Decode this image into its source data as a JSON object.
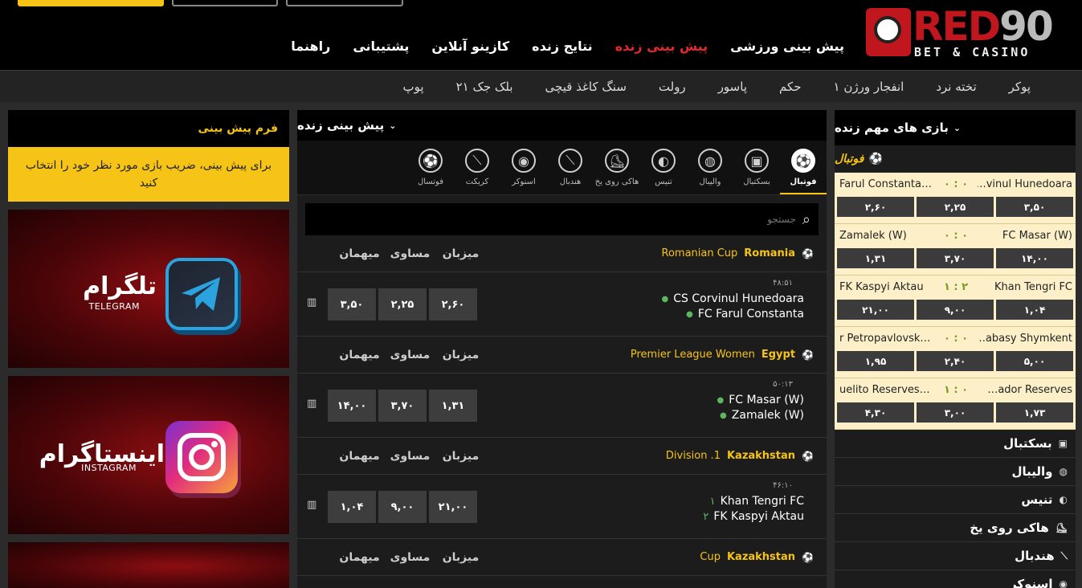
{
  "brand": {
    "logo_main": "RED90",
    "logo_r": "RED",
    "logo_n": "90",
    "logo_sub": "BET & CASINO"
  },
  "main_nav": [
    {
      "label": "پیش بینی ورزشی",
      "active": false
    },
    {
      "label": "پیش بینی زنده",
      "active": true
    },
    {
      "label": "نتایج زنده",
      "active": false
    },
    {
      "label": "کازینو آنلاین",
      "active": false
    },
    {
      "label": "پشتیبانی",
      "active": false
    },
    {
      "label": "راهنما",
      "active": false
    }
  ],
  "sub_nav": [
    "پوکر",
    "تخته نرد",
    "انفجار ورژن ۱",
    "حکم",
    "پاسور",
    "رولت",
    "سنگ کاغذ قیچی",
    "بلک جک ۲۱",
    "پوپ"
  ],
  "left": {
    "form_title": "فرم پیش بینی",
    "form_note": "برای پیش بینی، ضریب بازی مورد نظر خود را انتخاب کنید",
    "telegram": {
      "fa": "تلگرام",
      "en": "TELEGRAM"
    },
    "instagram": {
      "fa": "اینستاگرام",
      "en": "INSTAGRAM"
    }
  },
  "center": {
    "title": "پیش بینی زنده",
    "tabs": [
      {
        "label": "فوتبال",
        "icon": "football-icon",
        "glyph": "⚽",
        "active": true
      },
      {
        "label": "بسکتبال",
        "icon": "basketball-icon",
        "glyph": "▣",
        "active": false
      },
      {
        "label": "والیبال",
        "icon": "volleyball-icon",
        "glyph": "◍",
        "active": false
      },
      {
        "label": "تنیس",
        "icon": "tennis-icon",
        "glyph": "◐",
        "active": false
      },
      {
        "label": "هاکی روی یخ",
        "icon": "ice-hockey-icon",
        "glyph": "⛸",
        "active": false
      },
      {
        "label": "هندبال",
        "icon": "handball-icon",
        "glyph": "⟋",
        "active": false
      },
      {
        "label": "اسنوکر",
        "icon": "snooker-icon",
        "glyph": "◉",
        "active": false
      },
      {
        "label": "کریکت",
        "icon": "cricket-icon",
        "glyph": "⟋",
        "active": false
      },
      {
        "label": "فوتسال",
        "icon": "futsal-icon",
        "glyph": "⚽",
        "active": false
      }
    ],
    "search_placeholder": "جستجو",
    "col_home": "میزبان",
    "col_draw": "مساوی",
    "col_away": "میهمان",
    "leagues": [
      {
        "country": "Romania",
        "name": "Romanian Cup",
        "matches": [
          {
            "time": "۴۸:۵۱",
            "home": "CS Corvinul Hunedoara",
            "away": "FC Farul Constanta",
            "home_score": "",
            "away_score": "",
            "odds": [
              "۲,۶۰",
              "۲,۲۵",
              "۳,۵۰"
            ]
          }
        ]
      },
      {
        "country": "Egypt",
        "name": "Premier League Women",
        "matches": [
          {
            "time": "۵۰:۱۳",
            "home": "FC Masar (W)",
            "away": "Zamalek (W)",
            "home_score": "",
            "away_score": "",
            "odds": [
              "۱,۳۱",
              "۳,۷۰",
              "۱۴,۰۰"
            ]
          }
        ]
      },
      {
        "country": "Kazakhstan",
        "name": "Division .1",
        "matches": [
          {
            "time": "۴۶:۱۰",
            "home": "Khan Tengri FC",
            "away": "FK Kaspyi Aktau",
            "home_score": "۱",
            "away_score": "۲",
            "odds": [
              "۲۱,۰۰",
              "۹,۰۰",
              "۱,۰۴"
            ]
          }
        ]
      },
      {
        "country": "Kazakhstan",
        "name": "Cup",
        "matches": []
      }
    ]
  },
  "right": {
    "title": "بازی های مهم زنده",
    "football_label": "فوتبال",
    "live": [
      {
        "home": "vinul Hunedoara…",
        "score": "۰ : ۰",
        "away": "Farul Constanta…",
        "odds": [
          "۲,۶۰",
          "۲,۲۵",
          "۳,۵۰"
        ]
      },
      {
        "home": "FC Masar (W)",
        "score": "۰ : ۰",
        "away": "Zamalek (W)",
        "odds": [
          "۱,۳۱",
          "۳,۷۰",
          "۱۴,۰۰"
        ]
      },
      {
        "home": "Khan Tengri FC",
        "score": "۱ : ۲",
        "away": "FK Kaspyi Aktau",
        "odds": [
          "۲۱,۰۰",
          "۹,۰۰",
          "۱,۰۴"
        ]
      },
      {
        "home": "abasy Shymkent…",
        "score": "۰ : ۰",
        "away": "r Petropavlovsk…",
        "odds": [
          "۱,۹۵",
          "۲,۴۰",
          "۵,۰۰"
        ]
      },
      {
        "home": "ador Reserves…",
        "score": "۱ : ۰",
        "away": "uelito Reserves…",
        "odds": [
          "۴,۳۰",
          "۳,۰۰",
          "۱,۷۳"
        ]
      }
    ],
    "sports": [
      {
        "label": "بسکتبال",
        "icon": "basketball-icon",
        "glyph": "▣"
      },
      {
        "label": "والیبال",
        "icon": "volleyball-icon",
        "glyph": "◍"
      },
      {
        "label": "تنیس",
        "icon": "tennis-icon",
        "glyph": "◐"
      },
      {
        "label": "هاکی روی یخ",
        "icon": "ice-hockey-icon",
        "glyph": "⛸"
      },
      {
        "label": "هندبال",
        "icon": "handball-icon",
        "glyph": "⟋"
      },
      {
        "label": "اسنوکر",
        "icon": "snooker-icon",
        "glyph": "◉"
      }
    ]
  },
  "colors": {
    "accent": "#f6c416",
    "active_nav": "#e5282d",
    "brand_red": "#c0161d",
    "live_bg": "#fdf0c9"
  }
}
